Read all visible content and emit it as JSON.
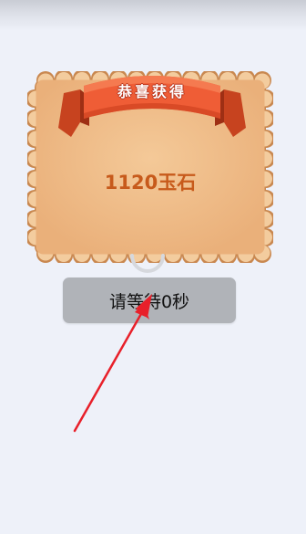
{
  "dialog": {
    "title": "恭喜获得",
    "reward": "1120玉石",
    "button_label": "请等待0秒"
  },
  "colors": {
    "background": "#eef1f9",
    "card_fill": "#f1bf88",
    "card_border": "#c98850",
    "ribbon": "#ee5c34",
    "reward_text": "#c75a1b",
    "button": "#b0b3b8",
    "arrow": "#e8202a"
  },
  "icons": {
    "ribbon_banner": "ribbon-banner-icon",
    "loading_spinner": "loading-spinner-icon",
    "annotation_arrow": "arrow-icon"
  }
}
